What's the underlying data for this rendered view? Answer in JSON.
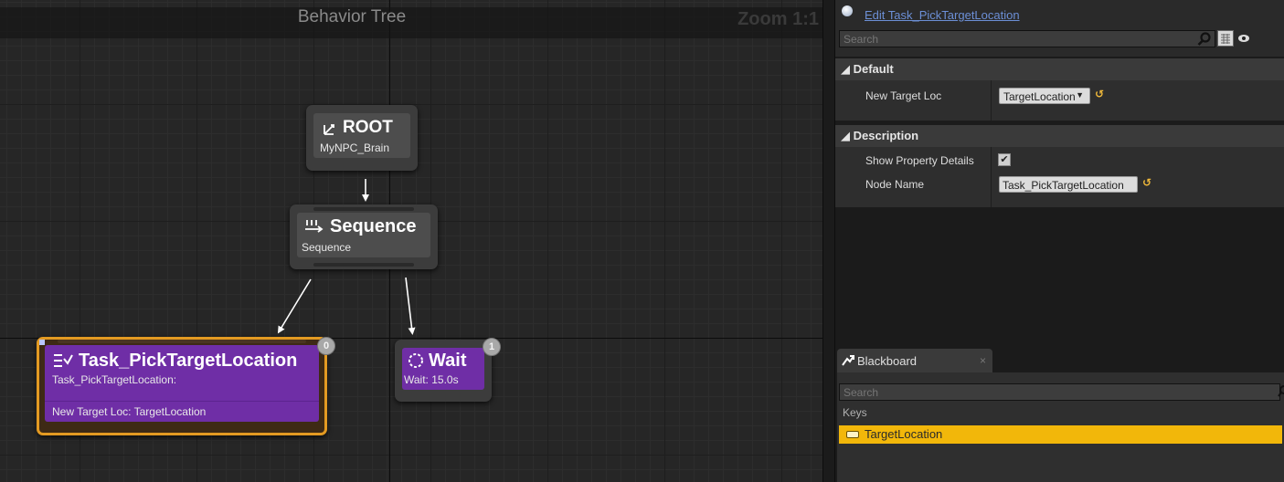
{
  "graph": {
    "title": "Behavior Tree",
    "zoom": "Zoom 1:1",
    "nodes": {
      "root": {
        "title": "ROOT",
        "subtitle": "MyNPC_Brain"
      },
      "sequence": {
        "title": "Sequence",
        "subtitle": "Sequence"
      },
      "task": {
        "title": "Task_PickTargetLocation",
        "subtitle": "Task_PickTargetLocation:",
        "detail": "New Target Loc: TargetLocation",
        "index": "0"
      },
      "wait": {
        "title": "Wait",
        "subtitle": "Wait: 15.0s",
        "index": "1"
      }
    }
  },
  "details": {
    "edit_link": "Edit Task_PickTargetLocation",
    "search_placeholder": "Search",
    "sections": {
      "default": {
        "label": "Default",
        "props": {
          "new_target_loc": {
            "label": "New Target Loc",
            "value": "TargetLocation"
          }
        }
      },
      "description": {
        "label": "Description",
        "props": {
          "show_property_details": {
            "label": "Show Property Details",
            "checked": true
          },
          "node_name": {
            "label": "Node Name",
            "value": "Task_PickTargetLocation"
          }
        }
      }
    }
  },
  "blackboard": {
    "tab_label": "Blackboard",
    "search_placeholder": "Search",
    "keys_label": "Keys",
    "keys": [
      "TargetLocation"
    ]
  },
  "colors": {
    "task_purple": "#6f2ea6",
    "selection_orange": "#e39a22",
    "key_highlight": "#f2b70a",
    "link_blue": "#6c8fd6"
  }
}
